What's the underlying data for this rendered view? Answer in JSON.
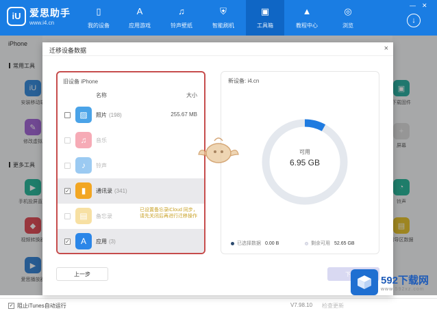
{
  "app": {
    "logo_mark": "iU",
    "name": "爱思助手",
    "url": "www.i4.cn",
    "nav": [
      {
        "label": "我的设备",
        "icon": "phone-icon",
        "glyph": "▯"
      },
      {
        "label": "应用游戏",
        "icon": "appstore-icon",
        "glyph": "A"
      },
      {
        "label": "铃声壁纸",
        "icon": "wallpaper-icon",
        "glyph": "♫"
      },
      {
        "label": "智能刷机",
        "icon": "shield-icon",
        "glyph": "⛨"
      },
      {
        "label": "工具箱",
        "icon": "toolbox-icon",
        "glyph": "▣"
      },
      {
        "label": "教程中心",
        "icon": "graduation-cap-icon",
        "glyph": "▲"
      },
      {
        "label": "浏览",
        "icon": "compass-icon",
        "glyph": "◎"
      }
    ],
    "active_tab": "工具箱",
    "accent_color": "#1a7de3"
  },
  "background": {
    "device_label": "iPhone",
    "sections": [
      "常用工具",
      "更多工具"
    ],
    "left_tools": [
      {
        "label": "安装移动端",
        "color": "#3b8ede",
        "icon": "mobile-install-icon",
        "glyph": "iU"
      },
      {
        "label": "修改虚拟",
        "color": "#a66ad8",
        "icon": "edit-icon",
        "glyph": "✎"
      },
      {
        "label": "手机投屏直播",
        "color": "#2fb89c",
        "icon": "cast-icon",
        "glyph": "▶"
      },
      {
        "label": "视频转换器",
        "color": "#e0505a",
        "icon": "video-convert-icon",
        "glyph": "◆"
      },
      {
        "label": "爱思播放器",
        "color": "#3a86d6",
        "icon": "player-icon",
        "glyph": "▶"
      }
    ],
    "right_tools": [
      {
        "label": "下载固件",
        "color": "#2fb0a3",
        "icon": "firmware-icon",
        "glyph": "▣"
      },
      {
        "label": "屏幕",
        "color": "#dddddd",
        "icon": "screen-icon",
        "glyph": "+"
      },
      {
        "label": "铃声",
        "color": "#2fb89c",
        "icon": "ringtone-icon",
        "glyph": "◔"
      },
      {
        "label": "引导区数据",
        "color": "#e8c531",
        "icon": "boot-data-icon",
        "glyph": "▤"
      }
    ]
  },
  "dialog": {
    "title": "迁移设备数据",
    "close": "×",
    "source_label": "旧设备 iPhone",
    "col_name": "名称",
    "col_size": "大小",
    "rows": [
      {
        "name": "照片",
        "count": "(198)",
        "size": "255.67 MB",
        "checked": false,
        "selected": false,
        "faded": false,
        "color": "#4aa3e8",
        "icon": "photos-icon",
        "glyph": "▨",
        "note": ""
      },
      {
        "name": "音乐",
        "count": "",
        "size": "",
        "checked": false,
        "selected": false,
        "faded": true,
        "color": "#ef5a6f",
        "icon": "music-icon",
        "glyph": "♫",
        "note": ""
      },
      {
        "name": "铃声",
        "count": "",
        "size": "",
        "checked": false,
        "selected": false,
        "faded": true,
        "color": "#3a97e6",
        "icon": "bell-icon",
        "glyph": "♪",
        "note": ""
      },
      {
        "name": "通讯录",
        "count": "(341)",
        "size": "",
        "checked": true,
        "selected": true,
        "faded": false,
        "color": "#f2a623",
        "icon": "contacts-icon",
        "glyph": "▮",
        "note": ""
      },
      {
        "name": "备忘录",
        "count": "",
        "size": "",
        "checked": false,
        "selected": false,
        "faded": true,
        "color": "#f1c24a",
        "icon": "notes-icon",
        "glyph": "▤",
        "note": "已设置备忘录iCloud 同步，请先关闭后再进行迁移操作"
      },
      {
        "name": "应用",
        "count": "(3)",
        "size": "",
        "checked": true,
        "selected": true,
        "faded": false,
        "color": "#2b86e8",
        "icon": "appstore-icon",
        "glyph": "A",
        "note": ""
      }
    ],
    "dest_label": "新设备: i4.cn",
    "storage": {
      "label": "可用",
      "value": "6.95 GB",
      "used_fraction": 0.08
    },
    "legend": [
      {
        "label": "已选择数据",
        "value": "0.00 B",
        "color": "#2c4a6e"
      },
      {
        "label": "剩余可用",
        "value": "52.65 GB",
        "color": "#e4e8ee"
      }
    ],
    "prev_button": "上一步",
    "next_button": "下一步"
  },
  "bottom": {
    "itunes_check": "✓",
    "itunes_label": "阻止iTunes自动运行",
    "version": "V7.98.10",
    "check_update": "检查更新"
  },
  "watermark": {
    "brand": "592下载网",
    "domain": "www.592xz.com"
  }
}
